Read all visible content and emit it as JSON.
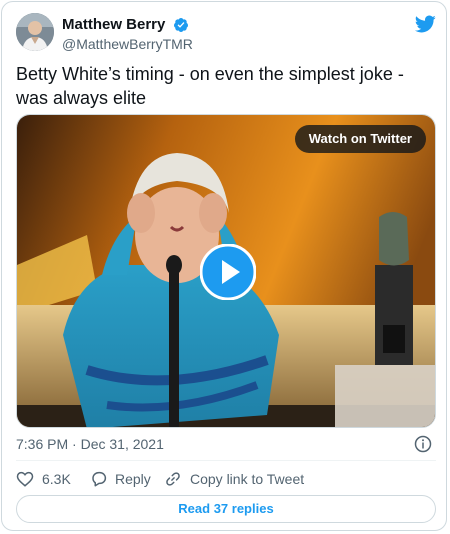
{
  "author": {
    "display_name": "Matthew Berry",
    "handle": "@MatthewBerryTMR",
    "verified": true
  },
  "tweet": {
    "text": "Betty White’s timing - on even the simplest joke - was always elite",
    "timestamp": "7:36 PM · Dec 31, 2021"
  },
  "media": {
    "watch_label": "Watch on Twitter"
  },
  "actions": {
    "like_count": "6.3K",
    "reply_label": "Reply",
    "copy_link_label": "Copy link to Tweet"
  },
  "footer": {
    "read_replies_label": "Read 37 replies"
  },
  "colors": {
    "accent": "#1d9bf0",
    "secondary_text": "#536471",
    "border": "#cfd9de"
  }
}
